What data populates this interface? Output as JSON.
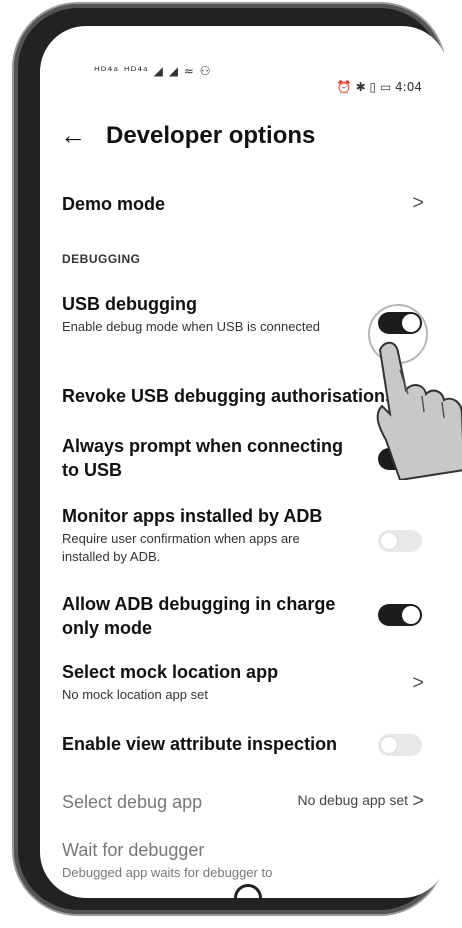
{
  "status_bar": {
    "left_icons": "ᴴᴰ⁴ᵃ ᴴᴰ⁴ᵃ ◢ ◢ ≈ ⚇",
    "right_text": "⏰ ✱ ▯ ▭ 4:04"
  },
  "header": {
    "back_icon": "arrow-left-icon",
    "title": "Developer options"
  },
  "items": {
    "demo_mode": {
      "label": "Demo mode",
      "chevron": ">"
    },
    "section_debugging": "DEBUGGING",
    "usb_debugging": {
      "label": "USB debugging",
      "sub": "Enable debug mode when USB is connected",
      "state": "on"
    },
    "revoke": {
      "label": "Revoke USB debugging authorisations"
    },
    "always_prompt": {
      "label": "Always prompt when connecting to USB",
      "state": "on"
    },
    "monitor_apps": {
      "label": "Monitor apps installed by ADB",
      "sub": "Require user confirmation when apps are installed by ADB.",
      "state": "off"
    },
    "charge_only": {
      "label": "Allow ADB debugging in charge only mode",
      "state": "on"
    },
    "mock_location": {
      "label": "Select mock location app",
      "sub": "No mock location app set",
      "chevron": ">"
    },
    "view_attribute": {
      "label": "Enable view attribute inspection",
      "state": "off"
    },
    "debug_app": {
      "label": "Select debug app",
      "value": "No debug app set",
      "chevron": ">"
    },
    "wait_debugger": {
      "label": "Wait for debugger",
      "sub": "Debugged app waits for debugger to"
    }
  }
}
